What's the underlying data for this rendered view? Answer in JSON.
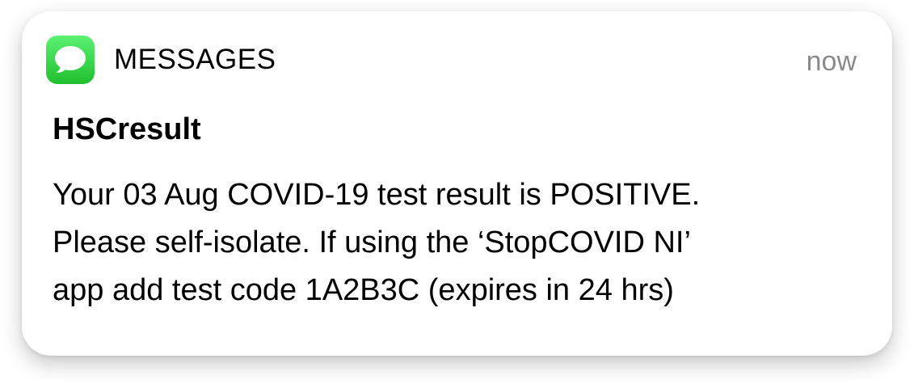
{
  "notification": {
    "app_icon": "messages-bubble-icon",
    "app_name": "MESSAGES",
    "timestamp": "now",
    "sender": "HSCresult",
    "body_lines": [
      "Your 03 Aug COVID-19 test result is POSITIVE.",
      "Please self-isolate. If using the ‘StopCOVID NI’",
      "app add test code 1A2B3C (expires in 24 hrs)"
    ]
  },
  "colors": {
    "icon_green_top": "#5cf173",
    "icon_green_bottom": "#1fbf2e",
    "timestamp_gray": "#8a8a8e"
  }
}
